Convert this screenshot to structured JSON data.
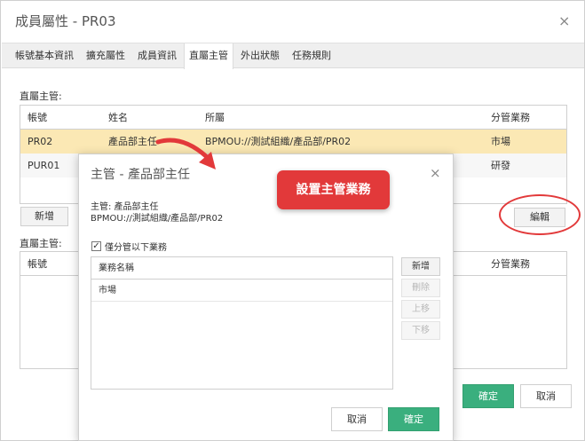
{
  "outer": {
    "title": "成員屬性 - PR03",
    "close_icon": "×",
    "tabs": [
      "帳號基本資訊",
      "擴充屬性",
      "成員資訊",
      "直屬主管",
      "外出狀態",
      "任務規則"
    ],
    "active_tab": "直屬主管",
    "supervisor_label": "直屬主管:",
    "supervisor_table": {
      "columns": [
        "帳號",
        "姓名",
        "所屬",
        "分管業務"
      ],
      "rows": [
        [
          "PR02",
          "產品部主任",
          "BPMOU://測試組織/產品部/PR02",
          "市場"
        ],
        [
          "PUR01",
          "",
          "",
          "研發"
        ]
      ]
    },
    "add_button": "新增",
    "edit_button": "編輯",
    "subordinate_label": "直屬主管:",
    "subordinate_table": {
      "columns": [
        "帳號",
        "分管業務"
      ]
    },
    "ok_button": "確定",
    "cancel_button": "取消"
  },
  "modal": {
    "title": "主管 - 產品部主任",
    "close_icon": "×",
    "supervisor_line": "主管: 產品部主任",
    "path_line": "BPMOU://測試組織/產品部/PR02",
    "checkbox_mark": "✓",
    "checkbox_label": "僅分管以下業務",
    "business_header": "業務名稱",
    "business_items": [
      "市場"
    ],
    "side_buttons": {
      "add": "新增",
      "delete": "刪除",
      "up": "上移",
      "down": "下移"
    },
    "cancel_button": "取消",
    "ok_button": "確定"
  },
  "annotation": {
    "callout_text": "設置主管業務"
  },
  "colors": {
    "accent_green": "#3aaf7e",
    "selected_row": "#fbe8b4",
    "annotation_red": "#e2393a"
  }
}
